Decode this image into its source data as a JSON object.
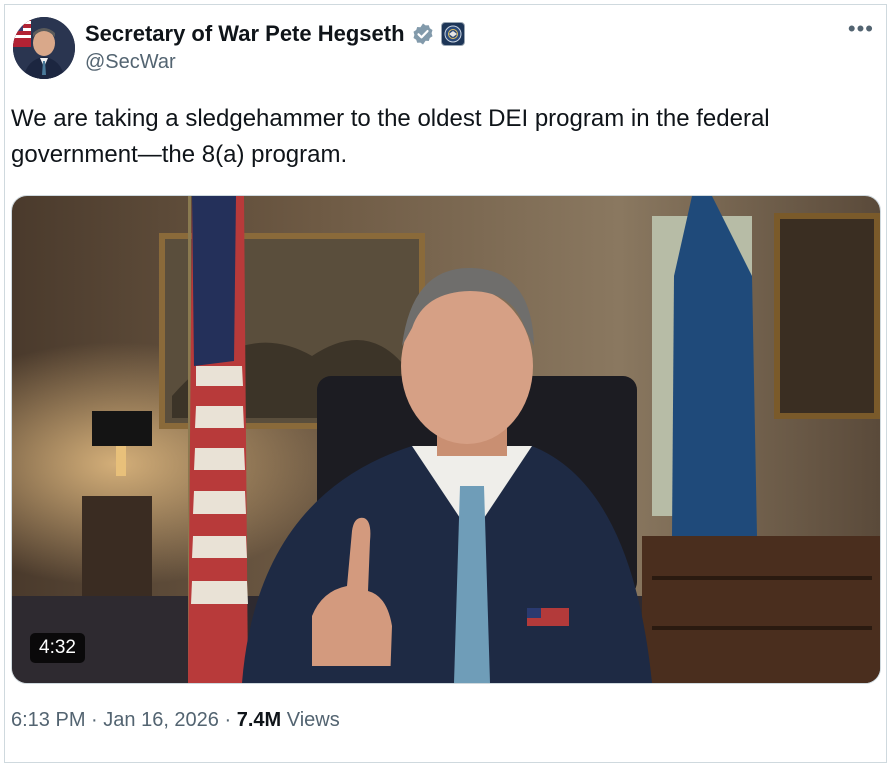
{
  "author": {
    "name": "Secretary of War Pete Hegseth",
    "handle": "@SecWar",
    "verified_icon": "verified-badge-icon",
    "affiliation_icon": "dod-seal-icon"
  },
  "menu": {
    "more_label": "•••"
  },
  "tweet": {
    "text": "We are taking a sledgehammer to the oldest DEI program in the federal government—the 8(a) program."
  },
  "media": {
    "type": "video",
    "duration": "4:32"
  },
  "meta": {
    "time": "6:13 PM",
    "separator1": " · ",
    "date": "Jan 16, 2026",
    "separator2": " · ",
    "views_count": "7.4M",
    "views_label": " Views"
  },
  "colors": {
    "text": "#0f1419",
    "secondary": "#536471",
    "border": "#cfd9de",
    "verified_gray": "#829aab"
  }
}
